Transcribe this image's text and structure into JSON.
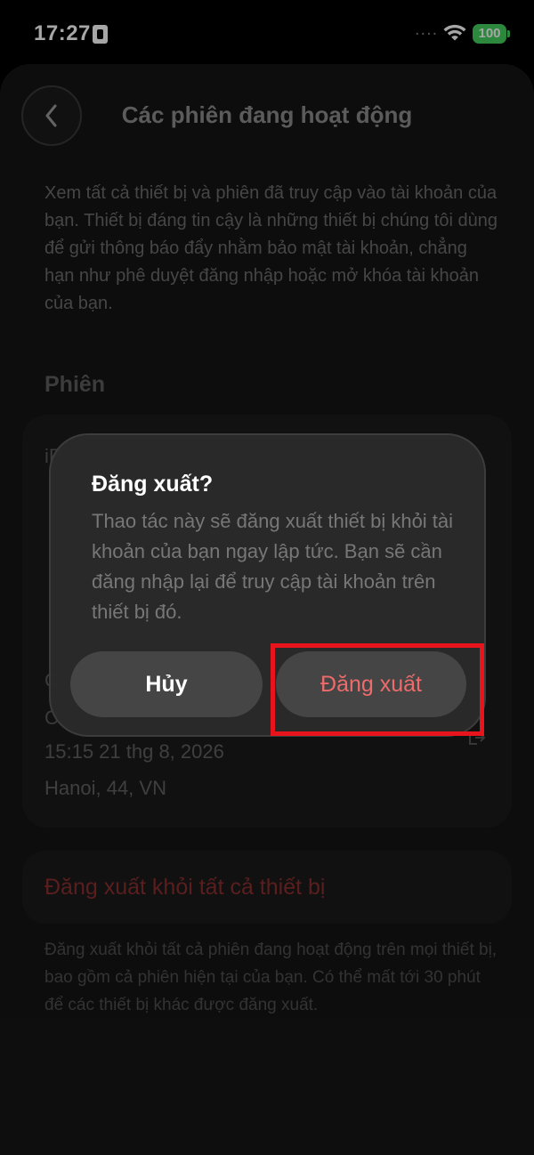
{
  "status_bar": {
    "time": "17:27",
    "battery": "100",
    "signal_dots": "....",
    "icons": [
      "contact-card-icon",
      "wifi-icon",
      "battery-icon"
    ]
  },
  "header": {
    "title": "Các phiên đang hoạt động",
    "back_icon": "chevron-left-icon"
  },
  "intro": "Xem tất cả thiết bị và phiên đã truy cập vào tài khoản của bạn. Thiết bị đáng tin cậy là những thiết bị chúng tôi dùng để gửi thông báo đẩy nhằm bảo mật tài khoản, chẳng hạn như phê duyệt đăng nhập hoặc mở khóa tài khoản của bạn.",
  "sessions": {
    "section_label": "Phiên",
    "fragments": [
      "iP",
      "C",
      "C"
    ],
    "time": "15:15 21 thg 8, 2026",
    "location": "Hanoi, 44, VN"
  },
  "logout_all": {
    "label": "Đăng xuất khỏi tất cả thiết bị",
    "description": "Đăng xuất khỏi tất cả phiên đang hoạt động trên mọi thiết bị, bao gồm cả phiên hiện tại của bạn. Có thể mất tới 30 phút để các thiết bị khác được đăng xuất."
  },
  "dialog": {
    "title": "Đăng xuất?",
    "message": "Thao tác này sẽ đăng xuất thiết bị khỏi tài khoản của bạn ngay lập tức. Bạn sẽ cần đăng nhập lại để truy cập tài khoản trên thiết bị đó.",
    "cancel_label": "Hủy",
    "confirm_label": "Đăng xuất"
  },
  "colors": {
    "highlight": "#e8141c",
    "danger": "#ee6b6b",
    "battery": "#43d15e"
  }
}
